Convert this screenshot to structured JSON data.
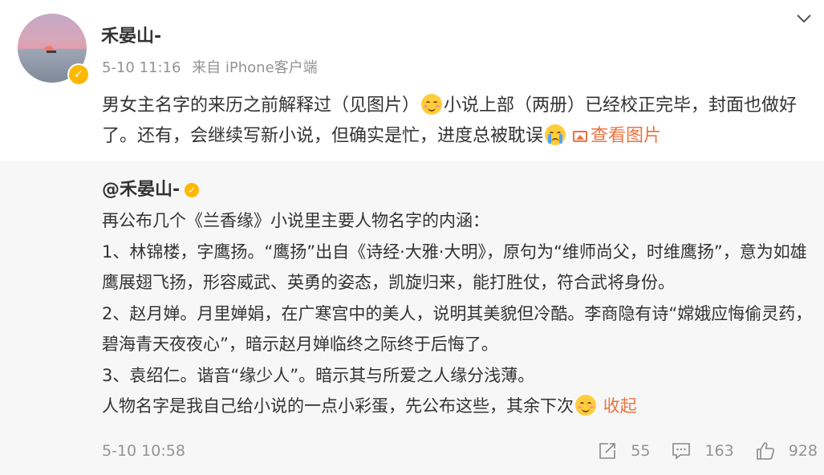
{
  "post": {
    "author": "禾晏山-",
    "time": "5-10 11:16",
    "source": "来自 iPhone客户端",
    "text_1": "男女主名字的来历之前解释过（见图片）",
    "text_2": "小说上部（两册）已经校正完毕，封面也做好了。还有，会继续写新小说，但确实是忙，进度总被耽误",
    "view_images_label": "查看图片"
  },
  "repost": {
    "author": "@禾晏山-",
    "lines": [
      "再公布几个《兰香缘》小说里主要人物名字的内涵：",
      "1、林锦楼，字鹰扬。“鹰扬”出自《诗经·大雅·大明》，原句为“维师尚父，时维鹰扬”，意为如雄鹰展翅飞扬，形容威武、英勇的姿态，凯旋归来，能打胜仗，符合武将身份。",
      "2、赵月婵。月里婵娟，在广寒宫中的美人，说明其美貌但冷酷。李商隐有诗“嫦娥应悔偷灵药，碧海青天夜夜心”，暗示赵月婵临终之际终于后悔了。",
      "3、袁绍仁。谐音“缘少人”。暗示其与所爱之人缘分浅薄。"
    ],
    "last_line": "人物名字是我自己给小说的一点小彩蛋，先公布这些，其余下次",
    "collapse_label": "收起",
    "time": "5-10 10:58",
    "reposts": "55",
    "comments": "163",
    "likes": "928"
  },
  "icons": [
    "chevron-down-icon",
    "verified-icon",
    "smile-emoji",
    "cry-emoji",
    "image-icon",
    "repost-icon",
    "comment-icon",
    "like-icon"
  ],
  "colors": {
    "link": "#eb7340",
    "meta": "#939393",
    "verified": "#ffb800",
    "repost_bg": "#f7f7f7"
  }
}
